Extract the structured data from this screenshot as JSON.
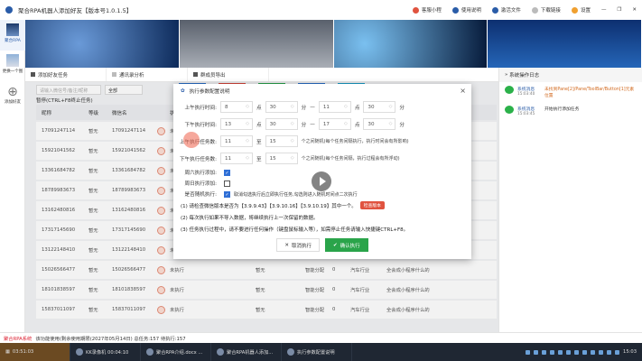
{
  "app": {
    "title": "聚合RPA机器人添加好友【版本号1.0.1.5】",
    "top_actions": [
      {
        "label": "客服小程",
        "color": "#e0533f"
      },
      {
        "label": "使用说明",
        "color": "#2a5ca8"
      },
      {
        "label": "激活文件",
        "color": "#2a5ca8"
      },
      {
        "label": "下载链接",
        "color": "#888888"
      },
      {
        "label": "设置",
        "color": "#f0a030"
      }
    ]
  },
  "sidebar": {
    "items": [
      {
        "label": "聚合RPA"
      },
      {
        "label": "更换一个图"
      },
      {
        "label": "添加好友"
      }
    ]
  },
  "tabs": [
    {
      "label": "添加好友任务"
    },
    {
      "label": "通讯录分析"
    },
    {
      "label": "群成员导出"
    }
  ],
  "toolbar": {
    "search_placeholder": "请输入微信号/备注/昵称",
    "filter_value": "全部",
    "color_buttons": [
      "#2a6fc9",
      "#d9463b",
      "#2aa44a",
      "#2a6fc9",
      "#1a9ec9"
    ]
  },
  "hint": "暂停(CTRL+F8终止任务)",
  "table": {
    "headers": [
      "昵称",
      "等级",
      "微信名",
      "",
      "状态",
      "备注",
      "分组",
      "数量",
      "行业",
      "公司"
    ],
    "rows": [
      [
        "17091247114",
        "暂无",
        "17091247114",
        "",
        "未执行",
        "暂无",
        "智能分配",
        "0",
        "汽车行业",
        "全会成小程序什么的"
      ],
      [
        "15921041562",
        "暂无",
        "15921041562",
        "",
        "未执行",
        "暂无",
        "智能分配",
        "0",
        "汽车行业",
        "全会成小程序什么的"
      ],
      [
        "13361684782",
        "暂无",
        "13361684782",
        "",
        "未执行",
        "暂无",
        "智能分配",
        "0",
        "汽车行业",
        "全会成小程序什么的"
      ],
      [
        "18789983673",
        "暂无",
        "18789983673",
        "",
        "未执行",
        "暂无",
        "智能分配",
        "0",
        "汽车行业",
        "全会成小程序什么的"
      ],
      [
        "13162480816",
        "暂无",
        "13162480816",
        "",
        "未执行",
        "暂无",
        "智能分配",
        "0",
        "汽车行业",
        "全会成小程序什么的"
      ],
      [
        "17317145690",
        "暂无",
        "17317145690",
        "",
        "未执行",
        "暂无",
        "智能分配",
        "0",
        "汽车行业",
        "全会成小程序什么的"
      ],
      [
        "13122148410",
        "暂无",
        "13122148410",
        "",
        "未执行",
        "暂无",
        "智能分配",
        "0",
        "汽车行业",
        "全会成小程序什么的"
      ],
      [
        "15026566477",
        "暂无",
        "15026566477",
        "",
        "未执行",
        "暂无",
        "智能分配",
        "0",
        "汽车行业",
        "全会成小程序什么的"
      ],
      [
        "18101838597",
        "暂无",
        "18101838597",
        "",
        "未执行",
        "暂无",
        "智能分配",
        "0",
        "汽车行业",
        "全会成小程序什么的"
      ],
      [
        "15837011097",
        "暂无",
        "15837011097",
        "",
        "未执行",
        "暂无",
        "智能分配",
        "0",
        "汽车行业",
        "全会成小程序什么的"
      ]
    ]
  },
  "right_panel": {
    "title": "系统操作日志",
    "messages": [
      {
        "who": "系统消息",
        "time": "15:03:40",
        "text": "未找到Pane[2]/Pane/ToolBar/Button[1]元素位置",
        "color": "#d2691e"
      },
      {
        "who": "系统消息",
        "time": "15:03:45",
        "text": "开始执行添加任务",
        "color": "#333333"
      }
    ]
  },
  "modal": {
    "title": "执行参数配置说明",
    "close": "×",
    "rows": [
      {
        "label": "上午执行时间:",
        "v1": "8",
        "u1": "点",
        "v2": "30",
        "u2": "分",
        "sep": "—",
        "v3": "11",
        "u3": "点",
        "v4": "30",
        "u4": "分"
      },
      {
        "label": "下午执行时间:",
        "v1": "13",
        "u1": "点",
        "v2": "30",
        "u2": "分",
        "sep": "—",
        "v3": "17",
        "u3": "点",
        "v4": "30",
        "u4": "分"
      }
    ],
    "tasks": [
      {
        "label": "上午执行任务数:",
        "v1": "11",
        "mid": "至",
        "v2": "15",
        "desc": "个之间随机(每个任务间隔执行，执行时间会有所影响)"
      },
      {
        "label": "下午执行任务数:",
        "v1": "11",
        "mid": "至",
        "v2": "15",
        "desc": "个之间随机(每个任务间隔，执行过程会有所浮动)"
      }
    ],
    "checks": [
      {
        "label": "周六执行添加:",
        "checked": true,
        "desc": ""
      },
      {
        "label": "周日执行添加:",
        "checked": false,
        "desc": ""
      },
      {
        "label": "是否随机执行:",
        "checked": true,
        "desc": "取消勾选执行后立即执行任务,勾选则进入随机时间点二次执行"
      }
    ],
    "notes": [
      "(1) 请检查微信版本是否为【3.9.9.43】【3.9.10.16】【3.9.10.19】其中一个。",
      "(2) 每次执行如果不导入数据，将继续执行上一次保留的数据。",
      "(3) 任务执行过程中，请不要进行任何操作（键盘鼠标输入等），如需停止任务请输入快捷键CTRL+F8。"
    ],
    "check_version": "检查版本",
    "cancel": "取消执行",
    "confirm": "确认执行"
  },
  "status": {
    "brand": "聚合RPA系统",
    "text": "该功能使用(剩余使用期限(2027年05月14日)  总任务:157 待执行:157"
  },
  "taskbar": {
    "clock": "03:51:03",
    "items": [
      "KK录像机 00:04:10",
      "聚合RPA介绍.docx ...",
      "聚合RPA机器人添加...",
      "执行参数配置说明"
    ],
    "time": "15:03"
  }
}
